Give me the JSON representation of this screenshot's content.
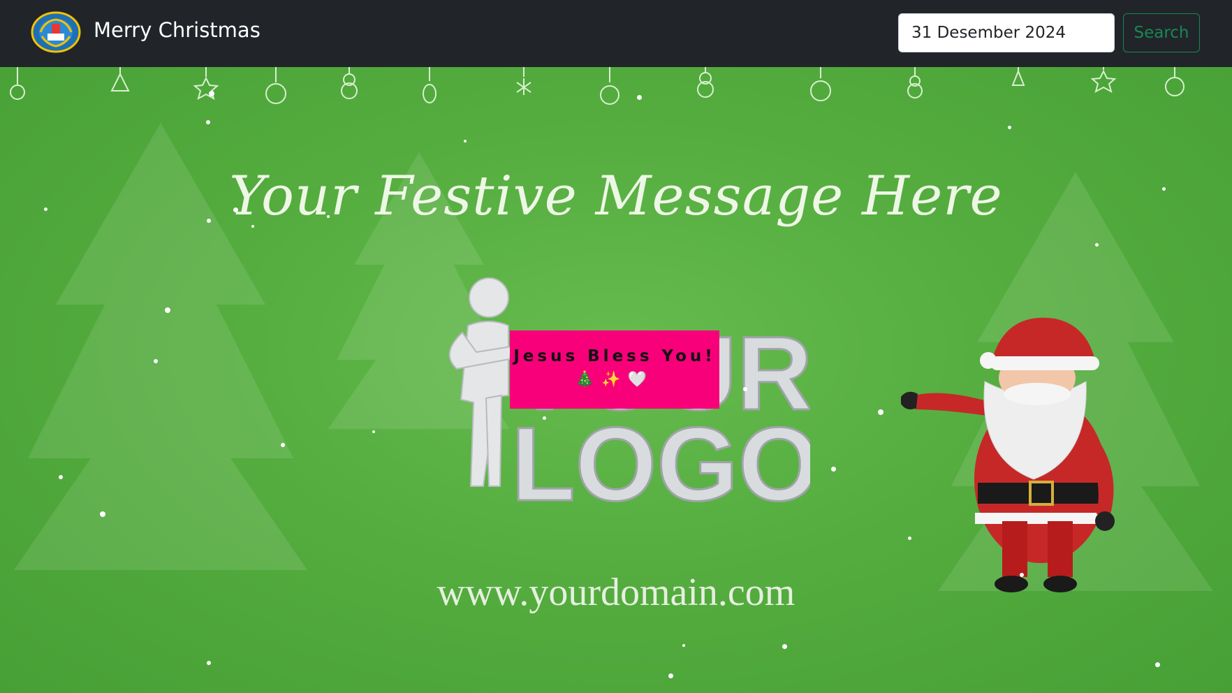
{
  "navbar": {
    "brand": "Merry Christmas",
    "search": {
      "value": "31 Desember 2024",
      "placeholder": "Search"
    },
    "search_button": "Search",
    "colors": {
      "background": "#212529",
      "button": "#198754"
    }
  },
  "banner": {
    "festive_message": "Your Festive Message Here",
    "logo_line1": "YOUR",
    "logo_line2": "LOGO",
    "domain": "www.yourdomain.com",
    "background_color": "#55ad3f"
  },
  "overlay": {
    "text": "Jesus Bless You!",
    "emojis": "🎄✨🤍",
    "color": "#f7007a"
  }
}
